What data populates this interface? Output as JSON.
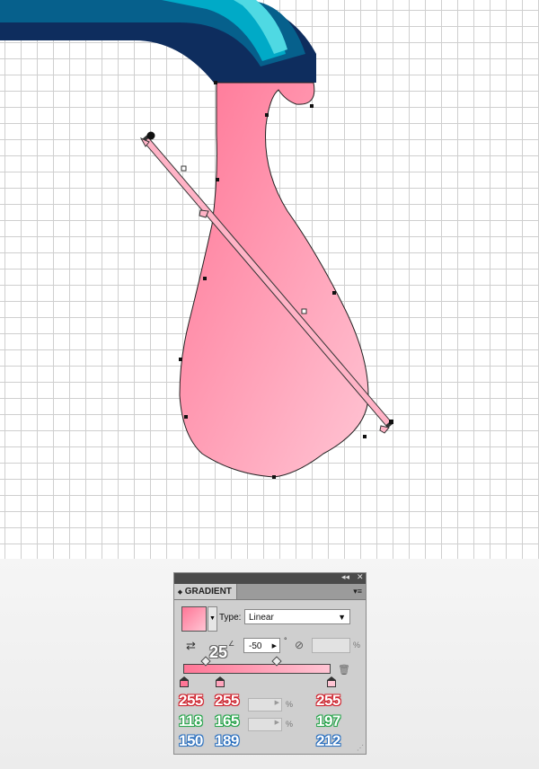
{
  "artboard": {
    "grid": true,
    "drop_gradient": {
      "type": "Linear",
      "start_color": "#ff7696",
      "end_color": "#ffc5d4"
    },
    "faucet_colors": {
      "outer": "#0e2d5e",
      "mid": "#06608c",
      "inner": "#00aac7",
      "highlight": "#4fd9e3"
    }
  },
  "gradient_panel": {
    "collapse_glyph": "◂◂",
    "close_glyph": "✕",
    "tab_label": "GRADIENT",
    "tab_arrow": "⬥",
    "menu_glyph": "▾≡",
    "type_label": "Type:",
    "type_value": "Linear",
    "angle_value": "-50",
    "angle_badge": "25",
    "degree_symbol": "°",
    "percent_symbol": "%",
    "stops": [
      {
        "r": "255",
        "g": "118",
        "b": "150",
        "color": "#ff7696"
      },
      {
        "r": "255",
        "g": "165",
        "b": "189",
        "color": "#ffa5bd"
      },
      {
        "r": "255",
        "g": "197",
        "b": "212",
        "color": "#ffc5d4"
      }
    ]
  }
}
